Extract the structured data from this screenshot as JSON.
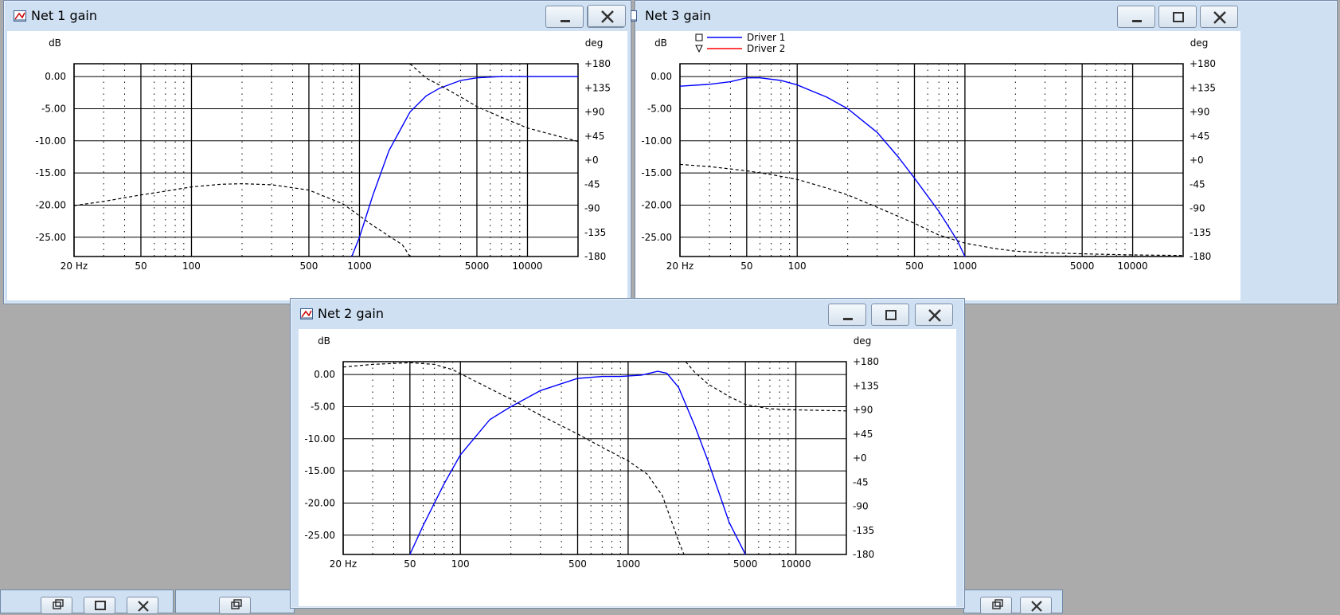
{
  "windows": [
    {
      "id": "net1",
      "title": "Net 1 gain",
      "left_unit": "dB",
      "right_unit": "deg",
      "db_ticks": [
        "0.00",
        "-5.00",
        "-10.00",
        "-15.00",
        "-20.00",
        "-25.00"
      ],
      "deg_ticks": [
        "+180",
        "+135",
        "+90",
        "+45",
        "+0",
        "-45",
        "-90",
        "-135",
        "-180"
      ],
      "x_ticks": [
        "20 Hz",
        "50",
        "100",
        "500",
        "1000",
        "5000",
        "10000"
      ],
      "legend": []
    },
    {
      "id": "net3",
      "title": "Net 3 gain",
      "left_unit": "dB",
      "right_unit": "deg",
      "db_ticks": [
        "0.00",
        "-5.00",
        "-10.00",
        "-15.00",
        "-20.00",
        "-25.00"
      ],
      "deg_ticks": [
        "+180",
        "+135",
        "+90",
        "+45",
        "+0",
        "-45",
        "-90",
        "-135",
        "-180"
      ],
      "x_ticks": [
        "20 Hz",
        "50",
        "100",
        "500",
        "1000",
        "5000",
        "10000"
      ],
      "legend": [
        {
          "label": "Driver 1",
          "color": "#0000ff",
          "marker": "square"
        },
        {
          "label": "Driver 2",
          "color": "#ff0000",
          "marker": "triangle"
        }
      ]
    },
    {
      "id": "net2",
      "title": "Net 2 gain",
      "left_unit": "dB",
      "right_unit": "deg",
      "db_ticks": [
        "0.00",
        "-5.00",
        "-10.00",
        "-15.00",
        "-20.00",
        "-25.00"
      ],
      "deg_ticks": [
        "+180",
        "+135",
        "+90",
        "+45",
        "+0",
        "-45",
        "-90",
        "-135",
        "-180"
      ],
      "x_ticks": [
        "20 Hz",
        "50",
        "100",
        "500",
        "1000",
        "5000",
        "10000"
      ],
      "legend": []
    }
  ],
  "colors": {
    "gain": "#0000ff",
    "phase": "#000000",
    "window_frame": "#cfe0f3",
    "desktop": "#ababab"
  },
  "icons": {
    "minimize": "minimize-icon",
    "maximize": "maximize-icon",
    "close": "close-icon",
    "app": "chart-window-icon"
  },
  "chart_data": [
    {
      "type": "line",
      "xlabel": "",
      "ylabel": "dB",
      "y2label": "deg",
      "xscale": "log",
      "xlim": [
        20,
        20000
      ],
      "ylim": [
        -28,
        2
      ],
      "y2lim": [
        -180,
        180
      ],
      "grid": true,
      "series": [
        {
          "axis": "left",
          "color": "#0000ff",
          "x": [
            900,
            1000,
            1200,
            1500,
            2000,
            2500,
            3000,
            4000,
            5000,
            7000,
            10000,
            20000
          ],
          "values": [
            -28,
            -25,
            -18.5,
            -11.5,
            -5.5,
            -3,
            -1.8,
            -0.6,
            -0.2,
            0,
            0,
            0
          ]
        },
        {
          "axis": "right",
          "color": "#000000",
          "dash": true,
          "x": [
            20,
            30,
            50,
            70,
            100,
            150,
            200,
            300,
            500,
            800,
            1200,
            1800,
            1999,
            2001,
            2500,
            3000,
            4000,
            5000,
            7000,
            10000,
            20000
          ],
          "values": [
            -85,
            -77,
            -65,
            -58,
            -50,
            -45,
            -44,
            -46,
            -56,
            -82,
            -122,
            -158,
            -180,
            180,
            153,
            140,
            118,
            100,
            80,
            60,
            35
          ]
        }
      ]
    },
    {
      "type": "line",
      "xlabel": "",
      "ylabel": "dB",
      "y2label": "deg",
      "xscale": "log",
      "xlim": [
        20,
        20000
      ],
      "ylim": [
        -28,
        2
      ],
      "y2lim": [
        -180,
        180
      ],
      "grid": true,
      "series": [
        {
          "name": "Driver 1",
          "axis": "left",
          "color": "#0000ff",
          "x": [
            20,
            30,
            40,
            50,
            60,
            80,
            100,
            150,
            200,
            300,
            400,
            500,
            700,
            900,
            1000
          ],
          "values": [
            -1.5,
            -1.2,
            -0.8,
            -0.2,
            -0.2,
            -0.6,
            -1.3,
            -3.2,
            -5,
            -8.7,
            -12.5,
            -15.8,
            -21,
            -25.5,
            -28
          ]
        },
        {
          "axis": "right",
          "color": "#000000",
          "dash": true,
          "x": [
            20,
            30,
            50,
            70,
            100,
            150,
            200,
            300,
            500,
            700,
            1000,
            1500,
            2000,
            3000,
            5000,
            10000,
            20000
          ],
          "values": [
            -8,
            -12,
            -20,
            -27,
            -36,
            -52,
            -65,
            -88,
            -118,
            -140,
            -155,
            -165,
            -170,
            -173,
            -175,
            -177,
            -178
          ]
        }
      ]
    },
    {
      "type": "line",
      "xlabel": "",
      "ylabel": "dB",
      "y2label": "deg",
      "xscale": "log",
      "xlim": [
        20,
        20000
      ],
      "ylim": [
        -28,
        2
      ],
      "y2lim": [
        -180,
        180
      ],
      "grid": true,
      "series": [
        {
          "axis": "left",
          "color": "#0000ff",
          "x": [
            50,
            60,
            70,
            80,
            100,
            150,
            200,
            300,
            500,
            700,
            900,
            1200,
            1500,
            1700,
            2000,
            2500,
            3000,
            4000,
            5000
          ],
          "values": [
            -28,
            -23.5,
            -20,
            -17,
            -12.5,
            -7,
            -5,
            -2.5,
            -0.6,
            -0.3,
            -0.3,
            -0.1,
            0.5,
            0.2,
            -2,
            -8,
            -13.5,
            -23,
            -28
          ]
        },
        {
          "axis": "right",
          "color": "#000000",
          "dash": true,
          "x": [
            20,
            30,
            50,
            70,
            90,
            120,
            200,
            300,
            500,
            700,
            1000,
            1300,
            1600,
            2000,
            2150,
            2200,
            2500,
            3000,
            4000,
            5000,
            7000,
            10000,
            20000
          ],
          "values": [
            170,
            175,
            178,
            175,
            165,
            145,
            110,
            80,
            45,
            20,
            -5,
            -30,
            -70,
            -155,
            -180,
            180,
            160,
            138,
            115,
            100,
            92,
            90,
            88
          ]
        }
      ]
    }
  ]
}
